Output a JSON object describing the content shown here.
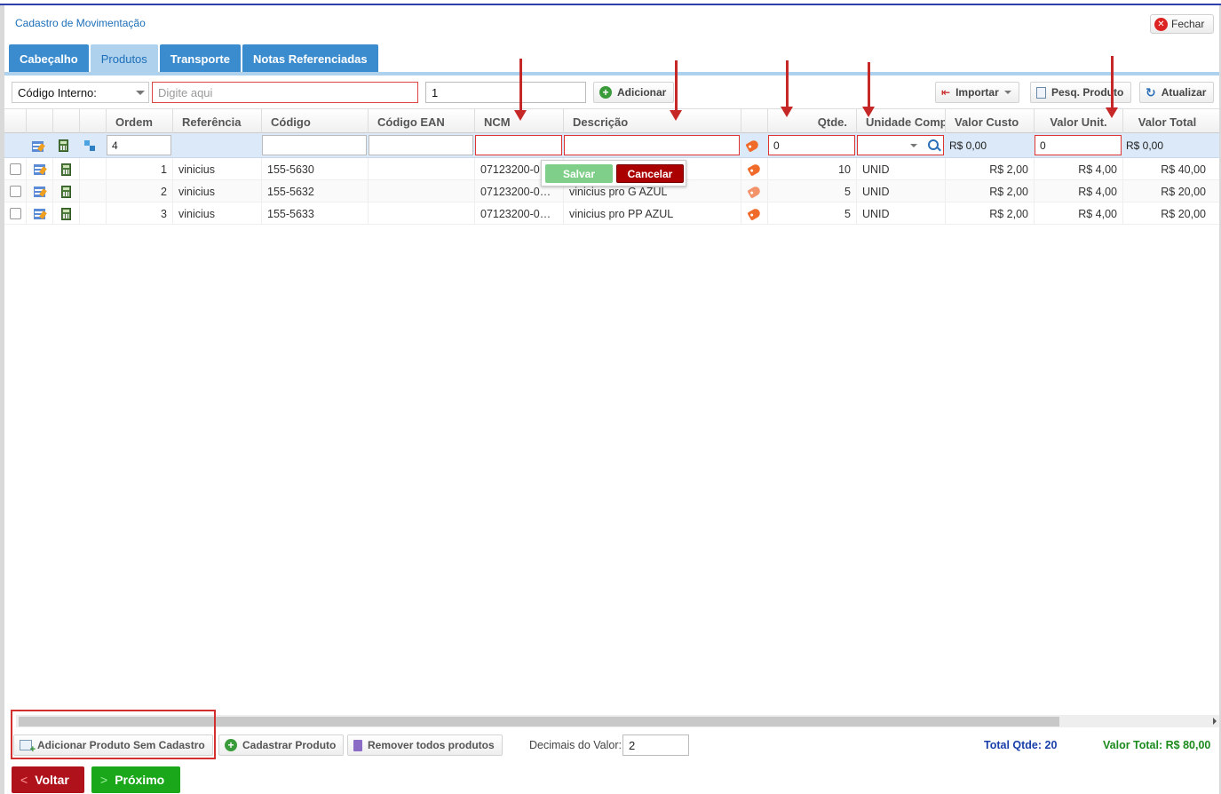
{
  "window": {
    "title": "Cadastro de Movimentação",
    "close_label": "Fechar"
  },
  "tabs": [
    {
      "label": "Cabeçalho",
      "active": false
    },
    {
      "label": "Produtos",
      "active": true
    },
    {
      "label": "Transporte",
      "active": false
    },
    {
      "label": "Notas Referenciadas",
      "active": false
    }
  ],
  "toolbar": {
    "search_type": "Código Interno:",
    "search_placeholder": "Digite aqui",
    "quantity_value": "1",
    "add_label": "Adicionar",
    "import_label": "Importar",
    "search_product_label": "Pesq. Produto",
    "refresh_label": "Atualizar"
  },
  "columns": {
    "ordem": "Ordem",
    "referencia": "Referência",
    "codigo": "Código",
    "codigo_ean": "Código EAN",
    "ncm": "NCM",
    "descricao": "Descrição",
    "qtde": "Qtde.",
    "unidade": "Unidade Comp",
    "valor_custo": "Valor Custo",
    "valor_unit": "Valor Unit.",
    "valor_total": "Valor Total"
  },
  "edit_row": {
    "ordem": "4",
    "referencia": "",
    "codigo": "",
    "codigo_ean": "",
    "ncm": "",
    "descricao": "",
    "qtde": "0",
    "unidade": "",
    "valor_custo": "R$ 0,00",
    "valor_unit": "0",
    "valor_total": "R$ 0,00"
  },
  "edit_popover": {
    "save_label": "Salvar",
    "cancel_label": "Cancelar"
  },
  "rows": [
    {
      "ordem": "1",
      "referencia": "vinicius",
      "codigo": "155-5630",
      "codigo_ean": "",
      "ncm": "07123200-0",
      "descricao": "",
      "qtde": "10",
      "unidade": "UNID",
      "valor_custo": "R$ 2,00",
      "valor_unit": "R$ 4,00",
      "valor_total": "R$ 40,00"
    },
    {
      "ordem": "2",
      "referencia": "vinicius",
      "codigo": "155-5632",
      "codigo_ean": "",
      "ncm": "07123200-0…",
      "descricao": "vinicius pro G AZUL",
      "qtde": "5",
      "unidade": "UNID",
      "valor_custo": "R$ 2,00",
      "valor_unit": "R$ 4,00",
      "valor_total": "R$ 20,00"
    },
    {
      "ordem": "3",
      "referencia": "vinicius",
      "codigo": "155-5633",
      "codigo_ean": "",
      "ncm": "07123200-0…",
      "descricao": "vinicius pro PP AZUL",
      "qtde": "5",
      "unidade": "UNID",
      "valor_custo": "R$ 2,00",
      "valor_unit": "R$ 4,00",
      "valor_total": "R$ 20,00"
    }
  ],
  "footer": {
    "add_unregistered_label": "Adicionar Produto Sem Cadastro",
    "register_product_label": "Cadastrar Produto",
    "remove_all_label": "Remover todos produtos",
    "decimals_label": "Decimais do Valor:",
    "decimals_value": "2",
    "total_qty": "Total Qtde: 20",
    "total_value": "Valor Total: R$ 80,00"
  },
  "nav": {
    "back_label": "Voltar",
    "next_label": "Próximo"
  },
  "colors": {
    "tab_blue": "#3b8ccf",
    "tab_active": "#aed1ee",
    "annotation_red": "#c62828",
    "back_red": "#b0121b",
    "next_green": "#1aa81a"
  }
}
